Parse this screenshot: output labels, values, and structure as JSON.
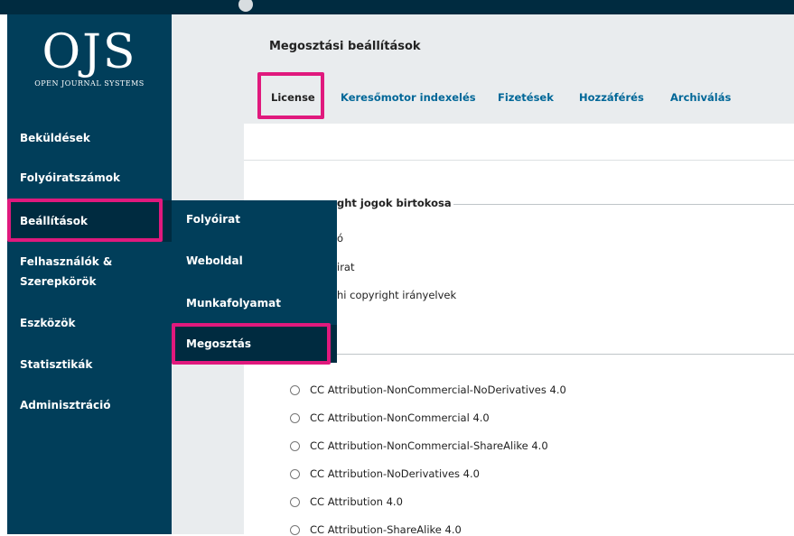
{
  "brand": {
    "logo_text": "OJS",
    "logo_subtitle": "OPEN JOURNAL SYSTEMS"
  },
  "colors": {
    "sidebar": "#013e5a",
    "sidebar_active": "#002b40",
    "highlight": "#e0197d",
    "link": "#006798"
  },
  "sidebar": {
    "items": [
      {
        "label": "Beküldések"
      },
      {
        "label": "Folyóiratszámok"
      },
      {
        "label": "Beállítások"
      },
      {
        "label": "Felhasználók &"
      },
      {
        "label": "Szerepkörök"
      },
      {
        "label": "Eszközök"
      },
      {
        "label": "Statisztikák"
      },
      {
        "label": "Adminisztráció"
      }
    ]
  },
  "submenu": {
    "items": [
      {
        "label": "Folyóirat"
      },
      {
        "label": "Weboldal"
      },
      {
        "label": "Munkafolyamat"
      },
      {
        "label": "Megosztás"
      }
    ]
  },
  "main": {
    "title": "Megosztási beállítások",
    "tabs": [
      {
        "label": "License"
      },
      {
        "label": "Keresőmotor indexelés"
      },
      {
        "label": "Fizetések"
      },
      {
        "label": "Hozzáférés"
      },
      {
        "label": "Archiválás"
      }
    ]
  },
  "copyright": {
    "legend": "ght jogok birtokosa",
    "options": [
      {
        "label": "ó"
      },
      {
        "label": "irat"
      },
      {
        "label": "hi copyright irányelvek"
      }
    ]
  },
  "license": {
    "options": [
      {
        "label": "CC Attribution-NonCommercial-NoDerivatives 4.0"
      },
      {
        "label": "CC Attribution-NonCommercial 4.0"
      },
      {
        "label": "CC Attribution-NonCommercial-ShareAlike 4.0"
      },
      {
        "label": "CC Attribution-NoDerivatives 4.0"
      },
      {
        "label": "CC Attribution 4.0"
      },
      {
        "label": "CC Attribution-ShareAlike 4.0"
      }
    ]
  }
}
